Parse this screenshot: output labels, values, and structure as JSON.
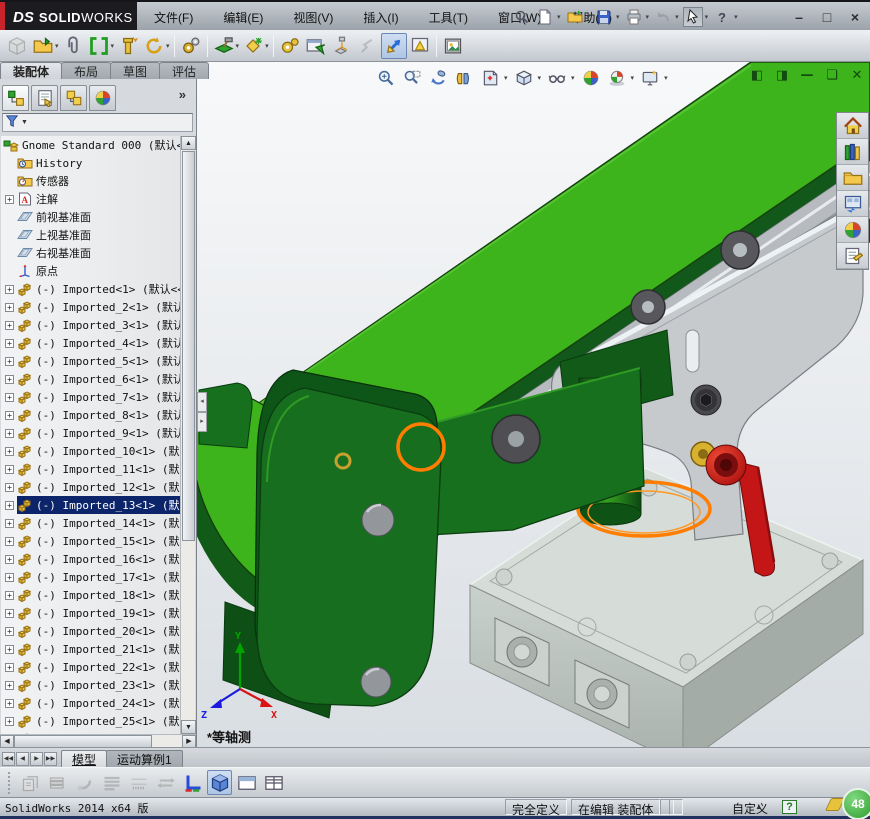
{
  "titlebar": {
    "logo_mark": "DS",
    "logo_text_bold": "SOLID",
    "logo_text_light": "WORKS",
    "menus": [
      "文件(F)",
      "编辑(E)",
      "视图(V)",
      "插入(I)",
      "工具(T)",
      "窗口(W)",
      "帮助(H)"
    ],
    "quick_icons": [
      "search",
      "new-doc",
      "open-folder",
      "save",
      "print",
      "undo",
      "cursor",
      "help-q"
    ],
    "window_buttons": {
      "minimize": "–",
      "maximize": "□",
      "close": "×"
    }
  },
  "toolbar": {
    "items": [
      {
        "icon": "insert-component",
        "disabled": true
      },
      {
        "icon": "open-part",
        "dd": true
      },
      {
        "icon": "attach-file"
      },
      {
        "icon": "mate",
        "dd": true
      },
      {
        "icon": "smart-fasteners"
      },
      {
        "icon": "move-component",
        "dd": true
      },
      {
        "sep": true
      },
      {
        "icon": "external-references"
      },
      {
        "sep": true
      },
      {
        "icon": "assembly-features",
        "dd": true
      },
      {
        "icon": "reference-geometry",
        "dd": true
      },
      {
        "sep": true
      },
      {
        "icon": "motion-gears"
      },
      {
        "icon": "preview-window"
      },
      {
        "icon": "exploded-view"
      },
      {
        "icon": "explode-line-sketch",
        "disabled": true
      },
      {
        "icon": "interference-detection",
        "pressed": true
      },
      {
        "icon": "assembly-visualization"
      },
      {
        "sep": true
      },
      {
        "icon": "capture-image"
      }
    ]
  },
  "ribbon_tabs": {
    "items": [
      "装配体",
      "布局",
      "草图",
      "评估"
    ],
    "active_index": 0
  },
  "feature_panel": {
    "header_tabs": [
      "pm-tree",
      "pm-props",
      "pm-config",
      "pm-display"
    ],
    "more_glyph": "»",
    "filter_arrow": "▼",
    "expander_glyph": "+",
    "scroll_glyphs": {
      "up": "▲",
      "down": "▼",
      "left": "◀",
      "right": "▶"
    },
    "tree": {
      "root": {
        "label": "Gnome Standard 000  (默认<",
        "icon": "t-root"
      },
      "rows": [
        {
          "icon": "t-history",
          "label": "History"
        },
        {
          "icon": "t-sensors",
          "label": "传感器"
        },
        {
          "icon": "t-annot",
          "label": "注解",
          "exp": true
        },
        {
          "icon": "t-plane",
          "label": "前视基准面"
        },
        {
          "icon": "t-plane",
          "label": "上视基准面"
        },
        {
          "icon": "t-plane",
          "label": "右视基准面"
        },
        {
          "icon": "t-origin",
          "label": "原点"
        },
        {
          "icon": "t-part",
          "label": "(-) Imported<1> (默认<<",
          "exp": true
        },
        {
          "icon": "t-part",
          "label": "(-) Imported_2<1> (默认",
          "exp": true
        },
        {
          "icon": "t-part",
          "label": "(-) Imported_3<1> (默认",
          "exp": true
        },
        {
          "icon": "t-part",
          "label": "(-) Imported_4<1> (默认",
          "exp": true
        },
        {
          "icon": "t-part",
          "label": "(-) Imported_5<1> (默认",
          "exp": true
        },
        {
          "icon": "t-part",
          "label": "(-) Imported_6<1> (默认",
          "exp": true
        },
        {
          "icon": "t-part",
          "label": "(-) Imported_7<1> (默认",
          "exp": true
        },
        {
          "icon": "t-part",
          "label": "(-) Imported_8<1> (默认",
          "exp": true
        },
        {
          "icon": "t-part",
          "label": "(-) Imported_9<1> (默认",
          "exp": true
        },
        {
          "icon": "t-part",
          "label": "(-) Imported_10<1> (默认",
          "exp": true
        },
        {
          "icon": "t-part",
          "label": "(-) Imported_11<1> (默认",
          "exp": true
        },
        {
          "icon": "t-part",
          "label": "(-) Imported_12<1> (默认",
          "exp": true
        },
        {
          "icon": "t-part",
          "label": "(-) Imported_13<1> (默认",
          "exp": true,
          "selected": true
        },
        {
          "icon": "t-part",
          "label": "(-) Imported_14<1> (默认",
          "exp": true
        },
        {
          "icon": "t-part",
          "label": "(-) Imported_15<1> (默认",
          "exp": true
        },
        {
          "icon": "t-part",
          "label": "(-) Imported_16<1> (默认",
          "exp": true
        },
        {
          "icon": "t-part",
          "label": "(-) Imported_17<1> (默认",
          "exp": true
        },
        {
          "icon": "t-part",
          "label": "(-) Imported_18<1> (默认",
          "exp": true
        },
        {
          "icon": "t-part",
          "label": "(-) Imported_19<1> (默认",
          "exp": true
        },
        {
          "icon": "t-part",
          "label": "(-) Imported_20<1> (默认",
          "exp": true
        },
        {
          "icon": "t-part",
          "label": "(-) Imported_21<1> (默认",
          "exp": true
        },
        {
          "icon": "t-part",
          "label": "(-) Imported_22<1> (默认",
          "exp": true
        },
        {
          "icon": "t-part",
          "label": "(-) Imported_23<1> (默认",
          "exp": true
        },
        {
          "icon": "t-part",
          "label": "(-) Imported_24<1> (默认",
          "exp": true
        },
        {
          "icon": "t-part",
          "label": "(-) Imported_25<1> (默认",
          "exp": true
        },
        {
          "icon": "t-part",
          "label": "",
          "exp": true
        }
      ]
    }
  },
  "viewport": {
    "headsup_icons": [
      {
        "icon": "zoom-fit"
      },
      {
        "icon": "zoom-area"
      },
      {
        "icon": "previous-view"
      },
      {
        "icon": "section-view"
      },
      {
        "icon": "view-orientation",
        "dd": true
      },
      {
        "icon": "display-style",
        "dd": true
      },
      {
        "icon": "hide-show-items",
        "dd": true
      },
      {
        "icon": "edit-appearance"
      },
      {
        "icon": "apply-scene",
        "dd": true
      },
      {
        "icon": "view-settings",
        "dd": true
      }
    ],
    "window_buttons": [
      {
        "name": "previous-window",
        "glyph": "◧"
      },
      {
        "name": "next-window",
        "glyph": "◨"
      },
      {
        "name": "minimize-doc",
        "glyph": "—"
      },
      {
        "name": "restore-doc",
        "glyph": "❏"
      },
      {
        "name": "close-doc",
        "glyph": "✕"
      }
    ],
    "view_label": "*等轴测",
    "triad": {
      "x": "X",
      "y": "Y",
      "z": "Z"
    },
    "highlight_color": "#ff7d00"
  },
  "task_pane": {
    "icons": [
      "home",
      "design-library",
      "file-explorer",
      "view-palette",
      "appearances",
      "custom-properties"
    ]
  },
  "bottom": {
    "nav_glyphs": [
      "◀◀",
      "◀",
      "▶",
      "▶▶"
    ],
    "tabs": {
      "items": [
        "模型",
        "运动算例1"
      ],
      "active_index": 0
    },
    "toolbar": [
      {
        "icon": "pages-icon",
        "disabled": true
      },
      {
        "icon": "layers-icon",
        "disabled": true
      },
      {
        "icon": "dye-icon",
        "disabled": true
      },
      {
        "icon": "lines-icon",
        "disabled": true
      },
      {
        "icon": "keyframe-icon",
        "disabled": true
      },
      {
        "icon": "swap-icon",
        "disabled": true
      },
      {
        "icon": "axes-icon"
      },
      {
        "icon": "iso-cube-icon",
        "pressed": true
      },
      {
        "icon": "pane-icon"
      },
      {
        "icon": "grid-pane-icon"
      }
    ]
  },
  "statusbar": {
    "app_version": "SolidWorks 2014 x64 版",
    "define_state": "完全定义",
    "edit_state": "在编辑 装配体",
    "custom_label": "自定义",
    "help_glyph": "?",
    "badge": "48"
  }
}
